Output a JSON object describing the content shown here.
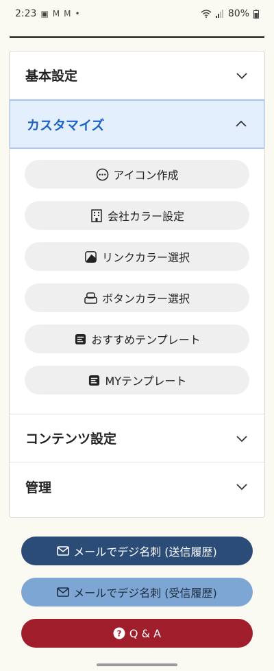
{
  "status_bar": {
    "time": "2:23",
    "battery": "80%"
  },
  "accordion": {
    "basic_settings": "基本設定",
    "customize": "カスタマイズ",
    "contents_settings": "コンテンツ設定",
    "management": "管理",
    "customize_items": [
      {
        "label": "アイコン作成",
        "icon": "dots-circle-icon"
      },
      {
        "label": "会社カラー設定",
        "icon": "building-icon"
      },
      {
        "label": "リンクカラー選択",
        "icon": "palette-icon"
      },
      {
        "label": "ボタンカラー選択",
        "icon": "button-icon"
      },
      {
        "label": "おすすめテンプレート",
        "icon": "template-icon"
      },
      {
        "label": "MYテンプレート",
        "icon": "template-icon"
      }
    ]
  },
  "buttons": {
    "mail_sent": "メールでデジ名刺 (送信履歴)",
    "mail_received": "メールでデジ名刺 (受信履歴)",
    "qa": "Q & A"
  }
}
